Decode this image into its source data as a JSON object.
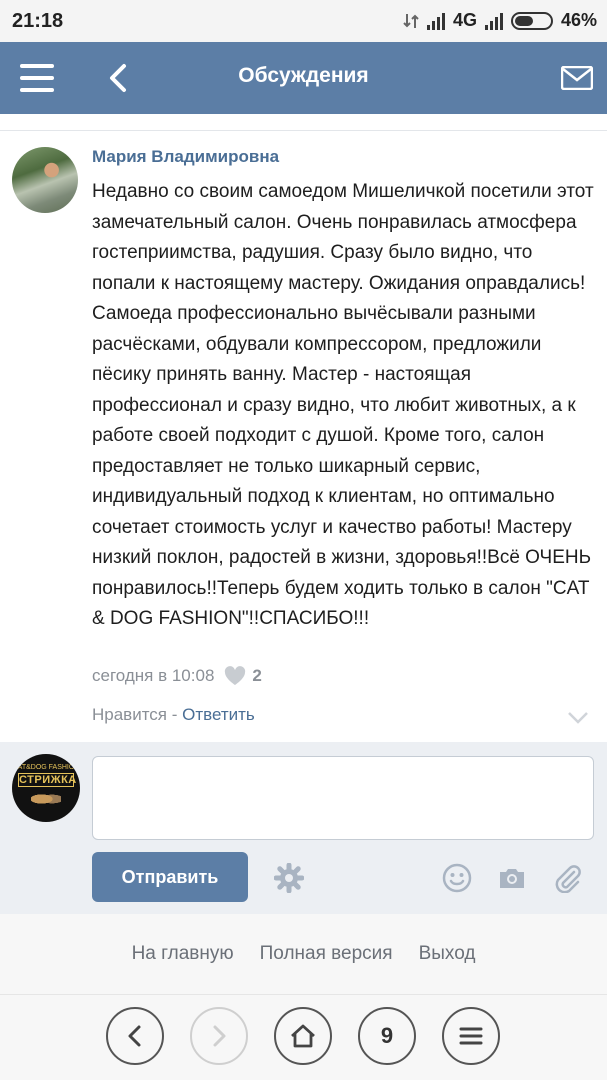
{
  "status_bar": {
    "time": "21:18",
    "network": "4G",
    "battery": "46%"
  },
  "header": {
    "title": "Обсуждения"
  },
  "post": {
    "author": "Мария Владимировна",
    "text": "Недавно со своим самоедом Мишеличкой посетили этот замечательный салон. Очень понравилась атмосфера гостеприимства, радушия. Сразу было видно, что попали к настоящему мастеру. Ожидания оправдались!Самоеда профессионально вычёсывали разными расчёсками, обдували компрессором, предложили пёсику принять ванну. Мастер - настоящая профессионал и сразу видно, что любит животных, а к работе своей подходит с душой. Кроме того, салон предоставляет не только шикарный сервис, индивидуальный подход к клиентам, но оптимально сочетает стоимость услуг и качество работы! Мастеру низкий поклон, радостей в жизни, здоровья!!Всё ОЧЕНЬ понравилось!!Теперь будем ходить только в салон \"CAT & DOG FASHION\"!!СПАСИБО!!!",
    "time": "сегодня в 10:08",
    "likes": "2",
    "like_label": "Нравится",
    "separator": " - ",
    "reply_label": "Ответить"
  },
  "composer": {
    "avatar_line1": "CAT&DOG FASHION",
    "avatar_line2": "СТРИЖКА",
    "placeholder": "",
    "send_label": "Отправить"
  },
  "footer": {
    "home": "На главную",
    "full_version": "Полная версия",
    "logout": "Выход"
  },
  "browser": {
    "tab_count": "9"
  },
  "colors": {
    "header_bg": "#5c7ea6",
    "link": "#4a6e95",
    "muted": "#8a8f96"
  }
}
